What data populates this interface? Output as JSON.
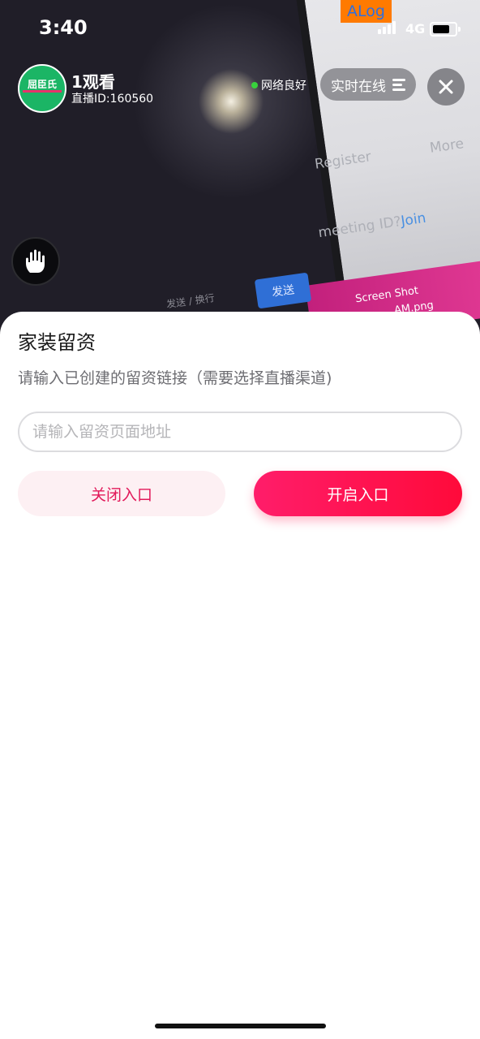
{
  "status_bar": {
    "time": "3:40",
    "debug_tag": "ALog",
    "network": "4G"
  },
  "live_header": {
    "avatar_text": "屈臣氏",
    "viewers": "1观看",
    "live_id": "直播ID:160560",
    "network_status": "网络良好",
    "online_button": "实时在线",
    "icons": {
      "close": "close-icon",
      "menu": "menu-lines-icon",
      "hand": "raise-hand-icon"
    }
  },
  "camera_scene": {
    "monitor_register": "Register",
    "monitor_more": "More",
    "monitor_meeting": "meeting ID?",
    "monitor_join": "Join",
    "send_chip": "发送",
    "keyboard_hint": "发送 / 换行",
    "file_line1": "Screen Shot",
    "file_line2": "AM.png"
  },
  "sheet": {
    "title": "家装留资",
    "description": "请输入已创建的留资链接（需要选择直播渠道)",
    "url_input": {
      "placeholder": "请输入留资页面地址",
      "value": ""
    },
    "close_entry_label": "关闭入口",
    "open_entry_label": "开启入口"
  },
  "colors": {
    "accent": "#ff1d6a",
    "accent_light_bg": "#fdf0f3",
    "network_dot": "#38d13c",
    "debug_tag_bg": "#ff7a00"
  }
}
